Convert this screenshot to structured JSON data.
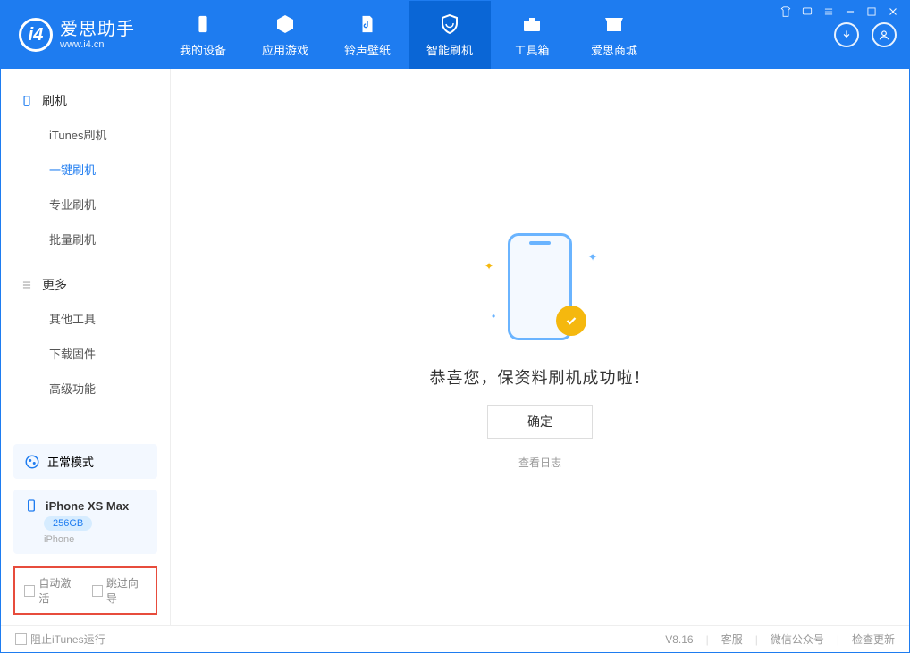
{
  "header": {
    "logo_title": "爱思助手",
    "logo_url": "www.i4.cn",
    "tabs": [
      {
        "label": "我的设备"
      },
      {
        "label": "应用游戏"
      },
      {
        "label": "铃声壁纸"
      },
      {
        "label": "智能刷机"
      },
      {
        "label": "工具箱"
      },
      {
        "label": "爱思商城"
      }
    ]
  },
  "sidebar": {
    "section1_title": "刷机",
    "section1_items": [
      "iTunes刷机",
      "一键刷机",
      "专业刷机",
      "批量刷机"
    ],
    "section2_title": "更多",
    "section2_items": [
      "其他工具",
      "下载固件",
      "高级功能"
    ],
    "mode_label": "正常模式",
    "device": {
      "name": "iPhone XS Max",
      "capacity": "256GB",
      "type": "iPhone"
    },
    "opt_auto_activate": "自动激活",
    "opt_skip_wizard": "跳过向导"
  },
  "main": {
    "message": "恭喜您，保资料刷机成功啦！",
    "ok_button": "确定",
    "view_log": "查看日志"
  },
  "footer": {
    "block_itunes": "阻止iTunes运行",
    "version": "V8.16",
    "links": [
      "客服",
      "微信公众号",
      "检查更新"
    ]
  }
}
